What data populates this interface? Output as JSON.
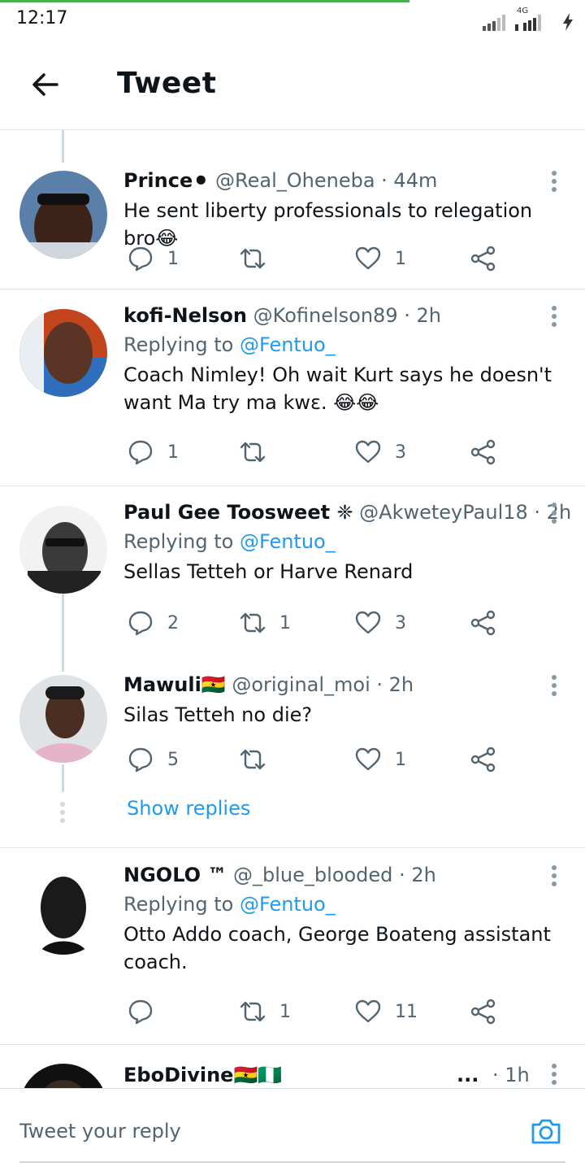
{
  "status_bar": {
    "time": "12:17",
    "network": "4G",
    "page_load_progress": 0.7
  },
  "header": {
    "back_icon": "arrow-left-icon",
    "title": "Tweet"
  },
  "tweets": [
    {
      "name": "Prince",
      "name_emoji": "⚫",
      "handle": "@Real_Oheneba",
      "time": "· 44m",
      "replying_to": "",
      "text": "He sent liberty professionals to relegation bro😂",
      "replies": "1",
      "retweets": "",
      "likes": "1"
    },
    {
      "name": "kofi-Nelson",
      "name_emoji": "",
      "handle": "@Kofinelson89",
      "time": "· 2h",
      "replying_prefix": "Replying to",
      "replying_to": "@Fentuo_",
      "text": "Coach Nimley! Oh wait Kurt says he doesn't want Ma try ma kwɛ. 😂😂",
      "replies": "1",
      "retweets": "",
      "likes": "3"
    },
    {
      "name": "Paul Gee Toosweet",
      "name_emoji": " ❈",
      "handle": "@AkweteyPaul18",
      "time": "· 2h",
      "replying_prefix": "Replying to",
      "replying_to": "@Fentuo_",
      "text": "Sellas Tetteh or Harve Renard",
      "replies": "2",
      "retweets": "1",
      "likes": "3"
    },
    {
      "name": "Mawuli",
      "name_emoji": "🇬🇭",
      "handle": "@original_moi",
      "time": "· 2h",
      "replying_to": "",
      "text": "Silas Tetteh no die?",
      "replies": "5",
      "retweets": "",
      "likes": "1"
    },
    {
      "name": "NGOLO ™",
      "name_emoji": "",
      "handle": "@_blue_blooded",
      "time": "· 2h",
      "replying_prefix": "Replying to",
      "replying_to": "@Fentuo_",
      "text": "Otto Addo coach, George Boateng assistant coach.",
      "replies": "",
      "retweets": "1",
      "likes": "11"
    },
    {
      "name": "EboDivine",
      "name_emoji": "🇬🇭🇳🇬",
      "handle": "...",
      "time": "· 1h"
    }
  ],
  "show_replies": "Show replies",
  "reply_bar": {
    "placeholder": "Tweet your reply",
    "camera_icon": "camera-icon"
  },
  "colors": {
    "accent": "#1d9bf0",
    "muted": "#536471",
    "thread_line": "#cfd9de"
  }
}
